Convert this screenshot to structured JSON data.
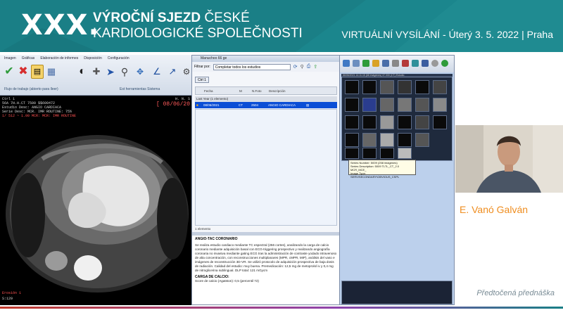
{
  "banner": {
    "xxx": "XXX.",
    "line1_bold": "VÝROČNÍ SJEZD",
    "line1_rest": " ČESKÉ",
    "line2": "KARDIOLOGICKÉ SPOLEČNOSTI",
    "right": "VIRTUÁLNÍ VYSÍLÁNÍ  - Úterý 3. 5. 2022 | Praha"
  },
  "viewer": {
    "menu": [
      "Imagen",
      "Gráficas",
      "Elaboración de informes",
      "Disposición",
      "Configuración"
    ],
    "sub_left": "Flujo de trabajo (abierto para lleer)",
    "sub_right": "Est herramientas Sistema",
    "ov_left": [
      "Ctrl 1",
      "56A 7H.H.CT 7500 $$600472",
      "Estudio Desc: ANGIO CARDIACA",
      "Serie Desc: MCR. IMR ROUTINE: 75%",
      "1/ 512 ~ 1.00 MCR: MCR: IMR ROUTINE"
    ],
    "date": "[ 08/06/20",
    "ov_right_top": "H. N. S",
    "ov_bottom": "Erosión 1",
    "ov_scale": "S:129"
  },
  "studylist": {
    "title": "Manuchoo 66 ge",
    "filter_label": "Filtrar por:",
    "filter_value": "Completar todos los estudios",
    "ctrl_button": "Ctrl 1",
    "headers": [
      "Fecha",
      "M",
      "N.Foto",
      "Descripción"
    ],
    "group": "Last Year (1 elemento)",
    "row": {
      "date": "08/06/2021",
      "mod": "CT",
      "num": "2504",
      "desc": "ANGIO CARDIACA"
    },
    "count": "1 elemento",
    "report_title": "ANGIO-TAC CORONARIO",
    "report_text": "Se realiza estudio cardiaco mediante TC espectral (256 cortes), analizando la carga de calcio coronario mediante adquisición basal con ECG-triggering prospectivo y realizando angiografía coronaria no invasiva mediante gating ECG tras la administración de contraste yodado intravenoso de alta concentración, con reconstrucciones multiplanares (MPR, cMPR, MIP), análisis del vaso e imágenes de reconstrucción 3D-VR. Se utilizó protocolo de adquisición prospectiva de baja dosis de radiación. Calidad del estudio: muy buena. Premedicación: 12,5 mg de metoprolol iv y 0,4 mg de nitroglicerina sublingual. DLP total: 121 mGycm",
    "report_sub": "CARGA DE CALCIO:",
    "report_sub_text": "Score de calcio (Agatston): 0,5 (percentil 72)"
  },
  "thumbs": {
    "header": "66/06/2021 14:11:15 (68 imágenes) 37 000 (CT) Estudio",
    "tooltip": [
      "Series Number: 5009 (258 imágenes)",
      "Series Description: 5009 TLTL_CT_2.0 MCR_MCE_",
      "Image Type: SERV\\SECONDARY\\OBVIOUS_CSPL"
    ]
  },
  "speaker": {
    "name": "E. Vanó Galván"
  },
  "footer": {
    "prerecorded": "Předtočená přednáška"
  },
  "colors": {
    "banner": "#1a7f86",
    "speaker_name": "#ef8d1f",
    "selected_row": "#0b4ed6"
  }
}
